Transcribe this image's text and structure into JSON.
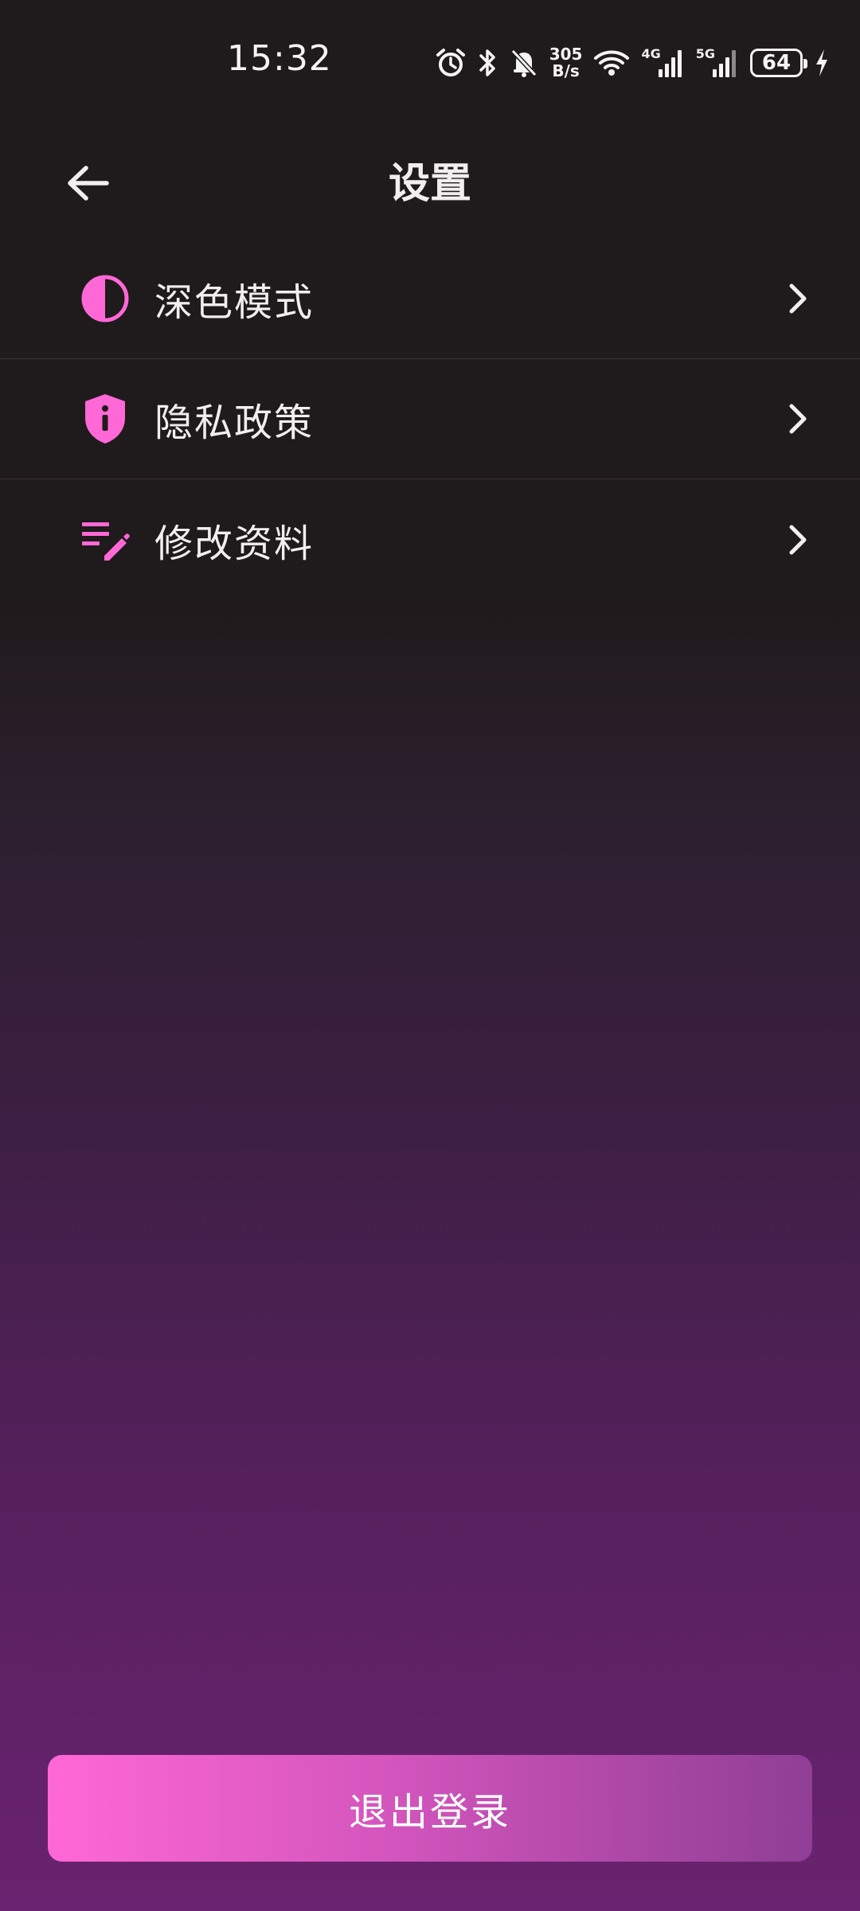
{
  "status_bar": {
    "time": "15:32",
    "net_speed_value": "305",
    "net_speed_unit": "B/s",
    "signal_1_label": "4G",
    "signal_2_label": "5G",
    "battery_level": "64",
    "icons": [
      "alarm-icon",
      "bluetooth-icon",
      "mute-icon",
      "wifi-icon",
      "signal-icon",
      "signal-icon",
      "battery-icon",
      "charging-icon"
    ]
  },
  "header": {
    "title": "设置",
    "back_icon": "arrow-left-icon"
  },
  "menu": {
    "items": [
      {
        "label": "深色模式",
        "icon": "half-circle-contrast-icon"
      },
      {
        "label": "隐私政策",
        "icon": "shield-info-icon"
      },
      {
        "label": "修改资料",
        "icon": "edit-list-icon"
      }
    ]
  },
  "logout": {
    "label": "退出登录"
  },
  "colors": {
    "accent": "#ff68d6",
    "background_top": "#1f1a1b",
    "background_bottom": "#6a2370"
  }
}
